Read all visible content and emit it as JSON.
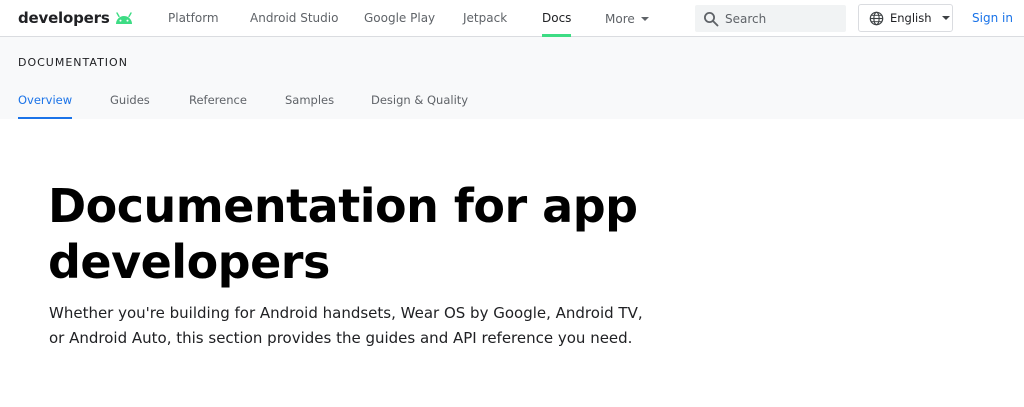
{
  "header": {
    "logo_text": "developers",
    "nav": [
      {
        "label": "Platform"
      },
      {
        "label": "Android Studio"
      },
      {
        "label": "Google Play"
      },
      {
        "label": "Jetpack"
      },
      {
        "label": "Docs",
        "active": true
      },
      {
        "label": "More"
      }
    ],
    "search": {
      "placeholder": "Search",
      "value": ""
    },
    "language": "English",
    "signin": "Sign in",
    "accent_color": "#3ddc84"
  },
  "subheader": {
    "title": "DOCUMENTATION",
    "tabs": [
      {
        "label": "Overview",
        "active": true
      },
      {
        "label": "Guides"
      },
      {
        "label": "Reference"
      },
      {
        "label": "Samples"
      },
      {
        "label": "Design & Quality"
      }
    ],
    "active_color": "#1a73e8"
  },
  "hero": {
    "title": "Documentation for app developers",
    "description": "Whether you're building for Android handsets, Wear OS by Google, Android TV, or Android Auto, this section provides the guides and API reference you need."
  }
}
